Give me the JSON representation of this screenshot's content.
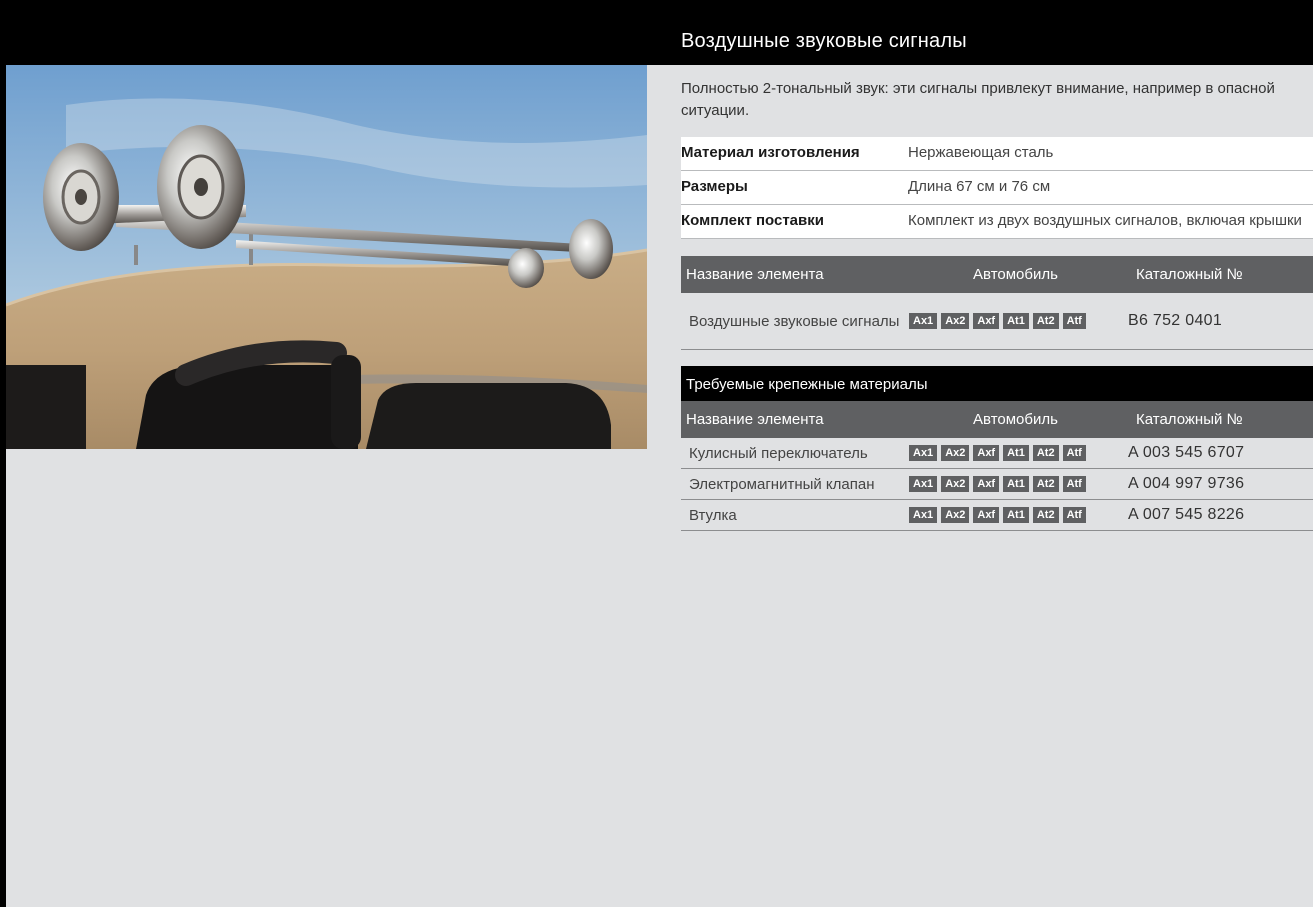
{
  "title": "Воздушные звуковые сигналы",
  "intro": "Полностью 2-тональный звук: эти сигналы привлекут внимание, например в опасной ситуации.",
  "specs": [
    {
      "label": "Материал изготовления",
      "value": "Нержавеющая сталь"
    },
    {
      "label": "Размеры",
      "value": "Длина 67 см и 76 см"
    },
    {
      "label": "Комплект поставки",
      "value": "Комплект из двух воздушных сигналов, включая крышки"
    }
  ],
  "table_header": {
    "name": "Название элемента",
    "vehicle": "Автомобиль",
    "part_no": "Каталожный №"
  },
  "vehicle_tags": [
    "Ax1",
    "Ax2",
    "Axf",
    "At1",
    "At2",
    "Atf"
  ],
  "main_item": {
    "name": "Воздушные звуковые сигналы",
    "part_no": "B6 752 0401"
  },
  "fixings_title": "Требуемые крепежные материалы",
  "fixings": [
    {
      "name": "Кулисный переключатель",
      "part_no": "A 003 545 6707"
    },
    {
      "name": "Электромагнитный клапан",
      "part_no": "A 004 997 9736"
    },
    {
      "name": "Втулка",
      "part_no": "A 007 545 8226"
    }
  ],
  "colors": {
    "header_gray": "#5f6062",
    "page_bg": "#e0e1e3",
    "black": "#000000"
  }
}
